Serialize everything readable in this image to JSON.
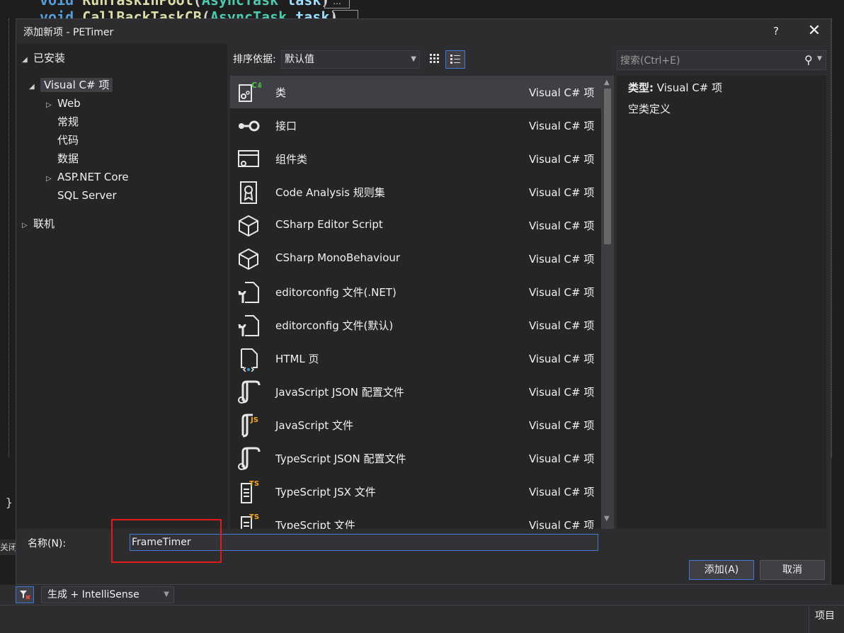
{
  "background": {
    "code_line1": [
      "void",
      " ",
      "RunTaskInPool",
      "(",
      "AsyncTask",
      " ",
      "task",
      ")"
    ],
    "code_line2": [
      "void",
      " ",
      "CallBackTaskCB",
      "(",
      "AsyncTask",
      " ",
      "task",
      ")"
    ],
    "ellipsis": "...",
    "brace": "}",
    "close_tab": "关闭",
    "filter_icon": "filter-icon",
    "build_select": "生成 + IntelliSense",
    "status_item": "项目"
  },
  "dialog": {
    "title": "添加新项 - PETimer",
    "help": "?",
    "close": "✕"
  },
  "tree": {
    "installed": "已安装",
    "visual_csharp": "Visual C# 项",
    "children": [
      "Web",
      "常规",
      "代码",
      "数据",
      "ASP.NET Core",
      "SQL Server"
    ],
    "online": "联机"
  },
  "toolbar": {
    "sort_label": "排序依据:",
    "sort_value": "默认值"
  },
  "items": [
    {
      "name": "类",
      "lang": "Visual C# 项",
      "icon": "class-icon"
    },
    {
      "name": "接口",
      "lang": "Visual C# 项",
      "icon": "interface-icon"
    },
    {
      "name": "组件类",
      "lang": "Visual C# 项",
      "icon": "component-icon"
    },
    {
      "name": "Code Analysis 规则集",
      "lang": "Visual C# 项",
      "icon": "ruleset-icon"
    },
    {
      "name": "CSharp Editor Script",
      "lang": "Visual C# 项",
      "icon": "cube-icon"
    },
    {
      "name": "CSharp MonoBehaviour",
      "lang": "Visual C# 项",
      "icon": "cube-icon"
    },
    {
      "name": "editorconfig 文件(.NET)",
      "lang": "Visual C# 项",
      "icon": "config-file-icon"
    },
    {
      "name": "editorconfig 文件(默认)",
      "lang": "Visual C# 项",
      "icon": "config-file-icon"
    },
    {
      "name": "HTML 页",
      "lang": "Visual C# 项",
      "icon": "html-file-icon"
    },
    {
      "name": "JavaScript JSON 配置文件",
      "lang": "Visual C# 项",
      "icon": "json-file-icon"
    },
    {
      "name": "JavaScript 文件",
      "lang": "Visual C# 项",
      "icon": "js-file-icon"
    },
    {
      "name": "TypeScript JSON 配置文件",
      "lang": "Visual C# 项",
      "icon": "json-file-icon"
    },
    {
      "name": "TypeScript JSX 文件",
      "lang": "Visual C# 项",
      "icon": "tsx-file-icon"
    },
    {
      "name": "TypeScript 文件",
      "lang": "Visual C# 项",
      "icon": "ts-file-icon"
    }
  ],
  "search": {
    "placeholder": "搜索(Ctrl+E)"
  },
  "details": {
    "type_label": "类型:",
    "type_value": "Visual C# 项",
    "description": "空类定义"
  },
  "name_field": {
    "label": "名称(N):",
    "value": "FrameTimer"
  },
  "buttons": {
    "add": "添加(A)",
    "cancel": "取消"
  },
  "colors": {
    "accent": "#3e7bd6",
    "highlight": "#e11b1b",
    "dialog_bg": "#2d2d30",
    "panel_bg": "#252526"
  }
}
